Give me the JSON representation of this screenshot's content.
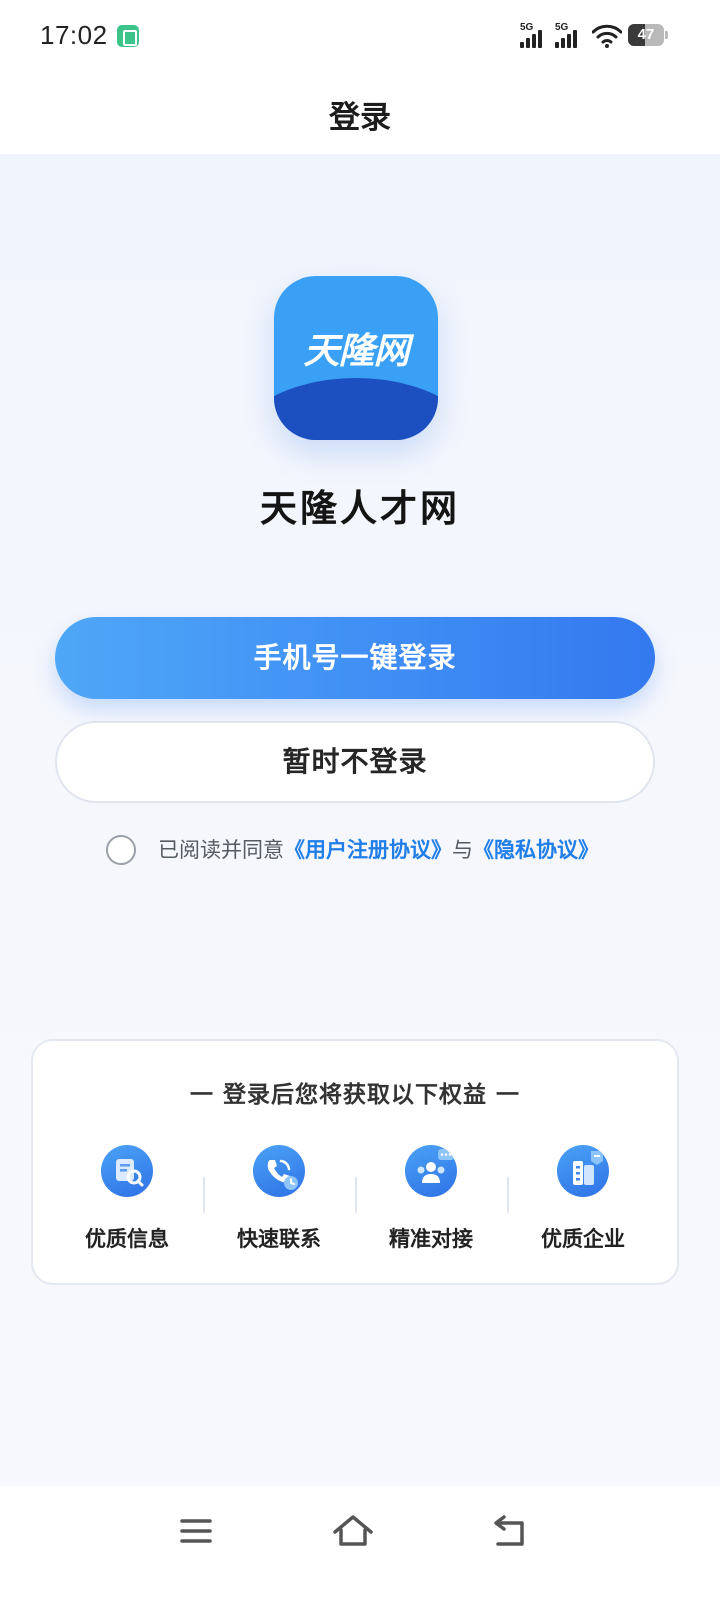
{
  "status_bar": {
    "time": "17:02",
    "signal1_label": "5G",
    "signal2_label": "5G",
    "battery_level": "47",
    "battery_fraction": 0.47,
    "notification_icon": "app-notification-icon"
  },
  "header": {
    "title": "登录"
  },
  "logo": {
    "text": "天隆网",
    "colors": {
      "sky": "#3aa0f5",
      "wave": "#1c4fc0"
    }
  },
  "app_name": "天隆人才网",
  "buttons": {
    "one_click_login": "手机号一键登录",
    "skip_login": "暂时不登录"
  },
  "agreement": {
    "prefix": "已阅读并同意",
    "user_agreement": "《用户注册协议》",
    "and": "与",
    "privacy_agreement": "《隐私协议》",
    "checked": false
  },
  "benefits": {
    "title": "一 登录后您将获取以下权益 一",
    "items": [
      {
        "label": "优质信息",
        "icon": "info-search-icon"
      },
      {
        "label": "快速联系",
        "icon": "phone-call-icon"
      },
      {
        "label": "精准对接",
        "icon": "people-chat-icon"
      },
      {
        "label": "优质企业",
        "icon": "building-badge-icon"
      }
    ]
  },
  "nav": {
    "menu_icon": "menu-icon",
    "home_icon": "home-icon",
    "back_icon": "back-icon"
  },
  "colors": {
    "accent": "#3f8ef5",
    "link": "#1f7ee8"
  }
}
